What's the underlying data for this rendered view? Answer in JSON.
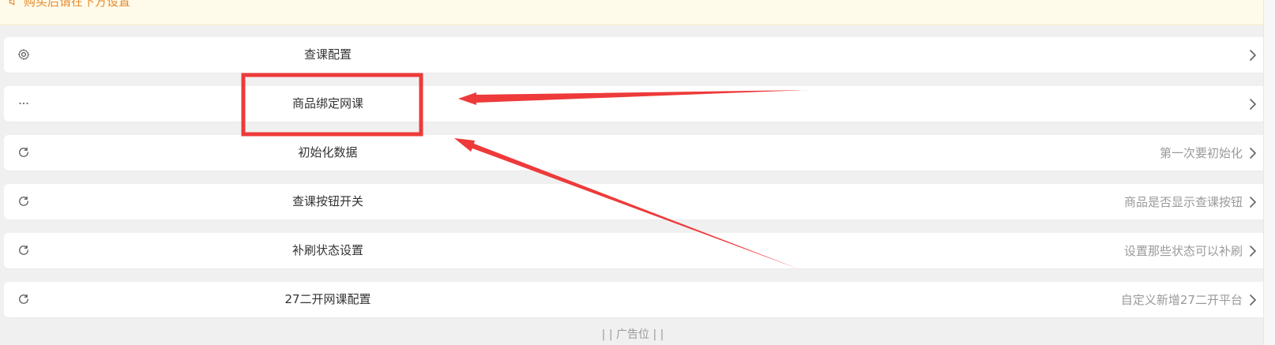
{
  "notice": {
    "text": "购买后请在下方设置",
    "icon": "speaker-icon",
    "color": "#e68a2e"
  },
  "rows": [
    {
      "icon": "gear-icon",
      "title": "查课配置",
      "desc": ""
    },
    {
      "icon": "more-horizontal-icon",
      "title": "商品绑定网课",
      "desc": ""
    },
    {
      "icon": "refresh-icon",
      "title": "初始化数据",
      "desc": "第一次要初始化"
    },
    {
      "icon": "refresh-icon",
      "title": "查课按钮开关",
      "desc": "商品是否显示查课按钮"
    },
    {
      "icon": "refresh-icon",
      "title": "补刷状态设置",
      "desc": "设置那些状态可以补刷"
    },
    {
      "icon": "refresh-icon",
      "title": "27二开网课配置",
      "desc": "自定义新增27二开平台"
    }
  ],
  "footer": {
    "ad_text": "| | 广告位 | |"
  },
  "annotation": {
    "highlight_color": "#ee3a3a",
    "arrow_color": "#ee3a3a"
  }
}
